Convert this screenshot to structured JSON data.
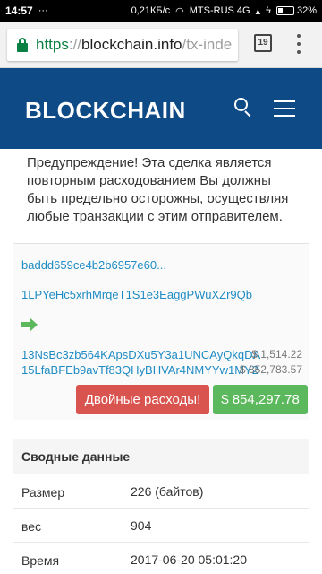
{
  "status_bar": {
    "time": "14:57",
    "speed": "0,21КБ/с",
    "carrier": "MTS-RUS 4G",
    "battery": "32%",
    "battery_level": 0.32
  },
  "browser": {
    "url_scheme": "https",
    "url_sep": "://",
    "url_host": "blockchain.info",
    "url_path": "/tx-inde",
    "tab_count": "19"
  },
  "header": {
    "logo": "BLOCKCHAIN",
    "search_icon": "search-icon",
    "menu_icon": "hamburger-menu-icon",
    "bg_color": "#0d4a86"
  },
  "warning_text": "Предупреждение! Эта сделка является повторным расходованием Вы должны быть предельно осторожны, осуществляя любые транзакции с этим отправителем.",
  "transaction": {
    "hash": "baddd659ce4b2b6957e60...",
    "input_address": "1LPYeHc5xrhMrqeT1S1e3EaggPWuXZr9Qb",
    "outputs": [
      {
        "address": "13NsBc3zb564KApsDXu5Y3a1UNCAyQkqDA",
        "amount": "$ 1,514.22"
      },
      {
        "address": "15LfaBFEb9avTf83QHyBHVAr4NMYYw1MY2",
        "amount": "$ 852,783.57"
      }
    ],
    "double_spend_label": "Двойные расходы!",
    "total_label": "$ 854,297.78",
    "colors": {
      "link": "#1e8bc3",
      "danger": "#d9534f",
      "success": "#5cb85c"
    }
  },
  "summary": {
    "title": "Сводные данные",
    "rows": [
      {
        "key": "Размер",
        "value": "226 (байтов)"
      },
      {
        "key": "вес",
        "value": "904"
      },
      {
        "key": "Время поступления",
        "value": "2017-06-20 05:01:20"
      }
    ]
  }
}
